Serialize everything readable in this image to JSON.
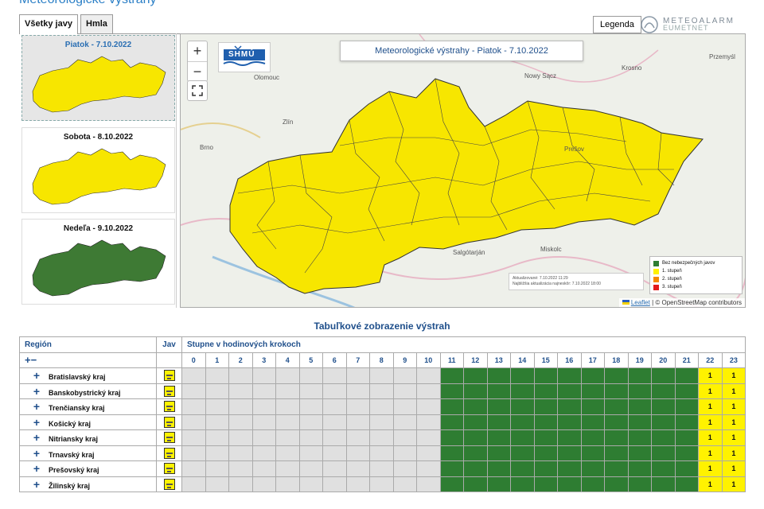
{
  "page_heading": "Meteorologické výstrahy",
  "tabs": [
    {
      "label": "Všetky javy"
    },
    {
      "label": "Hmla"
    }
  ],
  "legend_button": "Legenda",
  "meteoalarm": {
    "name": "METEOALARM",
    "sub": "EUMETNET"
  },
  "thumbnails": [
    {
      "label": "Piatok - 7.10.2022",
      "fill": "#f7e600"
    },
    {
      "label": "Sobota - 8.10.2022",
      "fill": "#f7e600"
    },
    {
      "label": "Nedeľa - 9.10.2022",
      "fill": "#3e7a34"
    }
  ],
  "map": {
    "title": "Meteorologické výstrahy - Piatok - 7.10.2022",
    "logo": "SHMÚ",
    "zoom_in": "+",
    "zoom_out": "−",
    "cities": [
      "Nowy Sącz",
      "Krosno",
      "Olomouc",
      "Zlín",
      "Prešov",
      "Miskolc",
      "Salgótarján",
      "Brno",
      "Przemyśl"
    ],
    "legend": [
      {
        "label": "Bez nebezpečných javov",
        "color": "#2e7d32"
      },
      {
        "label": "1. stupeň",
        "color": "#fff200"
      },
      {
        "label": "2. stupeň",
        "color": "#f58a00"
      },
      {
        "label": "3. stupeň",
        "color": "#e21b1b"
      }
    ],
    "updated_line1": "Aktualizované: 7.10.2022 11:29",
    "updated_line2": "Najbližšia aktualizácia najneskôr: 7.10.2022 18:00",
    "attribution_leaflet": "Leaflet",
    "attribution_rest": " | © OpenStreetMap contributors",
    "region_fill": "#f7e600"
  },
  "table": {
    "title": "Tabuľkové zobrazenie výstrah",
    "col_region": "Región",
    "col_jav": "Jav",
    "col_steps": "Stupne v hodinových krokoch",
    "expand_all": "+−",
    "hours": [
      "0",
      "1",
      "2",
      "3",
      "4",
      "5",
      "6",
      "7",
      "8",
      "9",
      "10",
      "11",
      "12",
      "13",
      "14",
      "15",
      "16",
      "17",
      "18",
      "19",
      "20",
      "21",
      "22",
      "23"
    ],
    "regions": [
      {
        "name": "Bratislavský kraj",
        "level_22": "1",
        "level_23": "1"
      },
      {
        "name": "Banskobystrický kraj",
        "level_22": "1",
        "level_23": "1"
      },
      {
        "name": "Trenčiansky kraj",
        "level_22": "1",
        "level_23": "1"
      },
      {
        "name": "Košický kraj",
        "level_22": "1",
        "level_23": "1"
      },
      {
        "name": "Nitriansky kraj",
        "level_22": "1",
        "level_23": "1"
      },
      {
        "name": "Trnavský kraj",
        "level_22": "1",
        "level_23": "1"
      },
      {
        "name": "Prešovský kraj",
        "level_22": "1",
        "level_23": "1"
      },
      {
        "name": "Žilinský kraj",
        "level_22": "1",
        "level_23": "1"
      }
    ],
    "gray_hours": [
      "0",
      "1",
      "2",
      "3",
      "4",
      "5",
      "6",
      "7",
      "8",
      "9",
      "10"
    ],
    "green_hours": [
      "11",
      "12",
      "13",
      "14",
      "15",
      "16",
      "17",
      "18",
      "19",
      "20",
      "21"
    ],
    "yellow_hours": [
      "22",
      "23"
    ]
  }
}
